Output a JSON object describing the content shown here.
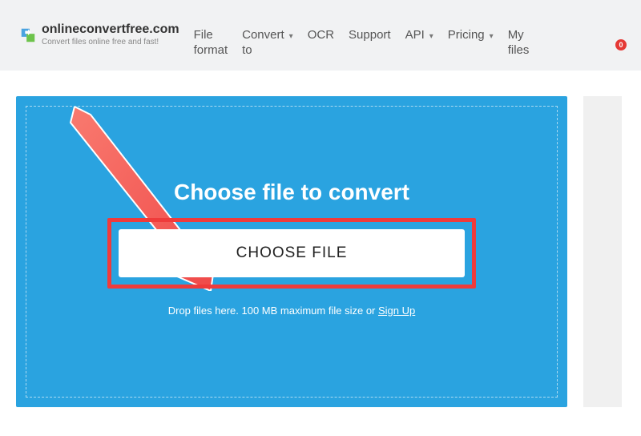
{
  "logo": {
    "title": "onlineconvertfree.com",
    "subtitle": "Convert files online free and fast!"
  },
  "nav": {
    "file_format": "File\nformat",
    "convert_to": "Convert\nto",
    "ocr": "OCR",
    "support": "Support",
    "api": "API",
    "pricing": "Pricing",
    "my_files": "My\nfiles"
  },
  "badge_count": "0",
  "panel": {
    "heading": "Choose file to convert",
    "button_label": "CHOOSE FILE",
    "hint_prefix": "Drop files here. 100 MB maximum file size or ",
    "hint_link": "Sign Up"
  }
}
